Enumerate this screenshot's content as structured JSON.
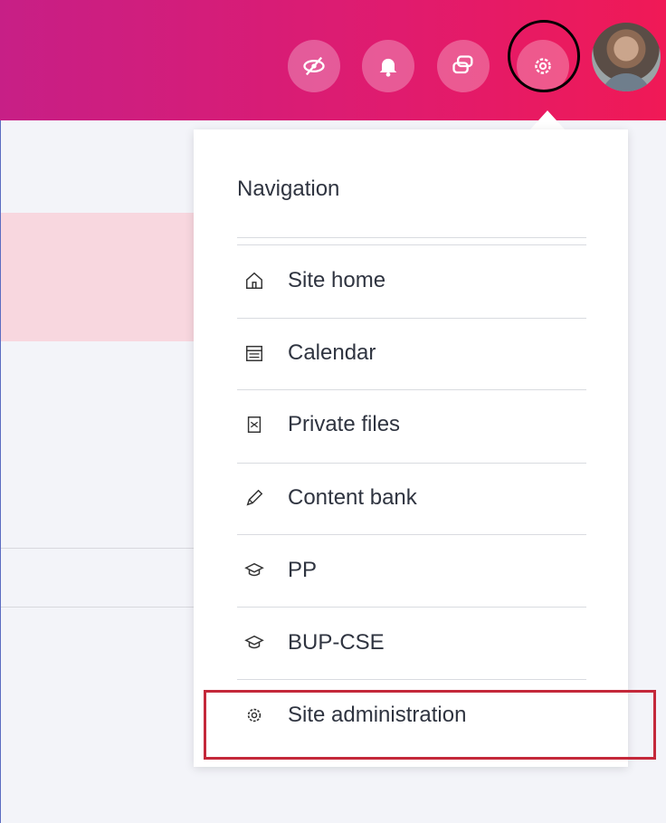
{
  "header": {
    "buttons": [
      {
        "icon": "eye-off-icon"
      },
      {
        "icon": "bell-icon"
      },
      {
        "icon": "chat-icon"
      },
      {
        "icon": "gear-icon"
      }
    ],
    "avatar": "user-avatar"
  },
  "menu": {
    "heading": "Navigation",
    "items": [
      {
        "label": "Site home",
        "icon": "home-icon"
      },
      {
        "label": "Calendar",
        "icon": "calendar-icon"
      },
      {
        "label": "Private files",
        "icon": "file-icon"
      },
      {
        "label": "Content bank",
        "icon": "pencil-icon"
      },
      {
        "label": "PP",
        "icon": "graduation-cap-icon"
      },
      {
        "label": "BUP-CSE",
        "icon": "graduation-cap-icon"
      },
      {
        "label": "Site administration",
        "icon": "gear-icon"
      }
    ]
  },
  "colors": {
    "header_start": "#c71f86",
    "header_end": "#f01956",
    "highlight_border": "#c4283a",
    "pink_band": "#f8d7df"
  }
}
